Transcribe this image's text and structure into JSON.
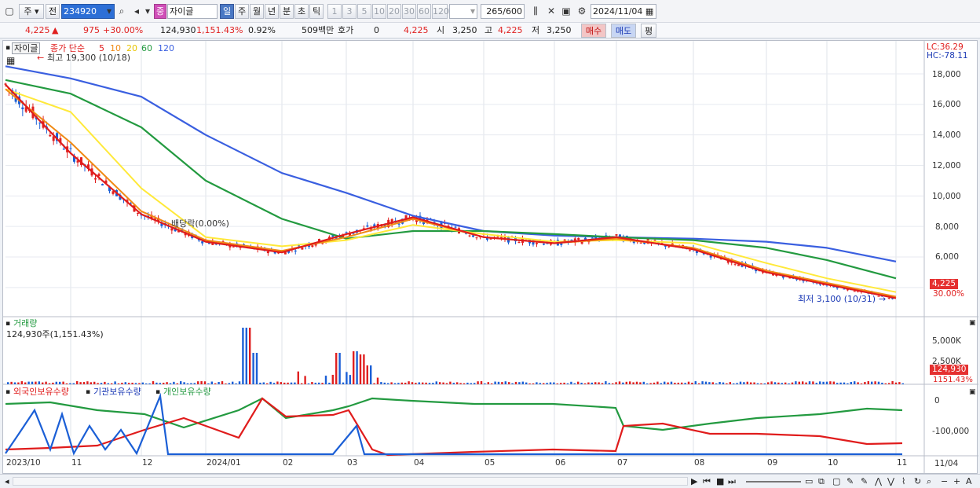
{
  "toolbar": {
    "mode_label": "주",
    "prev_label": "전",
    "code_value": "234920",
    "name_badge": "중",
    "name_value": "자이글",
    "period_tabs": [
      "일",
      "주",
      "월",
      "년",
      "분",
      "초",
      "틱"
    ],
    "interval_tabs": [
      "1",
      "3",
      "5",
      "10",
      "20",
      "30",
      "60",
      "120"
    ],
    "count_value": "265",
    "count_total": "/600",
    "date_value": "2024/11/04"
  },
  "quote": {
    "price": "4,225",
    "change": "975",
    "change_pct": "+30.00%",
    "volume": "124,930",
    "volume_pct": "1,151.43%",
    "turnover": "0.92%",
    "amount": "509백만",
    "hoga_label": "호가",
    "hoga_value": "0",
    "hoga_price": "4,225",
    "open_label": "시",
    "open_value": "3,250",
    "high_label": "고",
    "high_value": "4,225",
    "low_label": "저",
    "low_value": "3,250",
    "buy_label": "매수",
    "sell_label": "매도",
    "avg_label": "평"
  },
  "main_panel": {
    "stock_tag": "자이글",
    "legend_prefix": "종가 단순",
    "ma_labels": [
      "5",
      "10",
      "20",
      "60",
      "120"
    ],
    "high_annotation": "최고 19,300 (10/18)",
    "low_annotation": "최저 3,100 (10/31)",
    "dividend_annotation": "배당락(0.00%)",
    "lc_label": "LC:36.29",
    "hc_label": "HC:-78.11",
    "y_ticks": [
      "18,000",
      "16,000",
      "14,000",
      "12,000",
      "10,000",
      "8,000",
      "6,000"
    ],
    "last_price_tag": "4,225",
    "last_change_tag": "30.00%"
  },
  "volume_panel": {
    "title": "거래량",
    "info": "124,930주(1,151.43%)",
    "y_ticks": [
      "5,000K",
      "2,500K"
    ],
    "last_tag": "124,930",
    "last_pct": "1151.43%"
  },
  "holding_panel": {
    "series": [
      "외국인보유수량",
      "기관보유수량",
      "개인보유수량"
    ],
    "y_ticks": [
      "0",
      "-100,000"
    ]
  },
  "x_axis": {
    "labels": [
      "2023/10",
      "11",
      "12",
      "2024/01",
      "02",
      "03",
      "04",
      "05",
      "06",
      "07",
      "08",
      "09",
      "10",
      "11"
    ],
    "right_label": "11/04"
  },
  "colors": {
    "ma5": "#e01c1c",
    "ma10": "#f08a14",
    "ma20": "#ffe93a",
    "ma60": "#239a40",
    "ma120": "#3a5fe0",
    "up": "#e02020",
    "down": "#1b5fd6"
  },
  "chart_data": {
    "type": "line",
    "title": "",
    "x": [
      "2023/10",
      "11",
      "12",
      "2024/01",
      "02",
      "03",
      "04",
      "05",
      "06",
      "07",
      "08",
      "09",
      "10",
      "11"
    ],
    "ylim": [
      3000,
      19500
    ],
    "series": [
      {
        "name": "5",
        "values": [
          17300,
          12800,
          8800,
          7000,
          6300,
          7500,
          8600,
          7300,
          6900,
          7300,
          6500,
          5000,
          4200,
          3300
        ]
      },
      {
        "name": "10",
        "values": [
          17000,
          13500,
          9000,
          7100,
          6400,
          7300,
          8500,
          7300,
          6900,
          7200,
          6600,
          5100,
          4300,
          3400
        ]
      },
      {
        "name": "20",
        "values": [
          17000,
          15500,
          10500,
          7300,
          6700,
          7100,
          8100,
          7500,
          7000,
          7100,
          6900,
          5600,
          4600,
          3700
        ]
      },
      {
        "name": "60",
        "values": [
          17600,
          16700,
          14500,
          11000,
          8500,
          7200,
          7700,
          7700,
          7500,
          7300,
          7100,
          6600,
          5800,
          4600
        ]
      },
      {
        "name": "120",
        "values": [
          18500,
          17700,
          16500,
          14000,
          11500,
          10200,
          8700,
          7700,
          7400,
          7300,
          7200,
          7000,
          6600,
          5700
        ]
      }
    ]
  }
}
